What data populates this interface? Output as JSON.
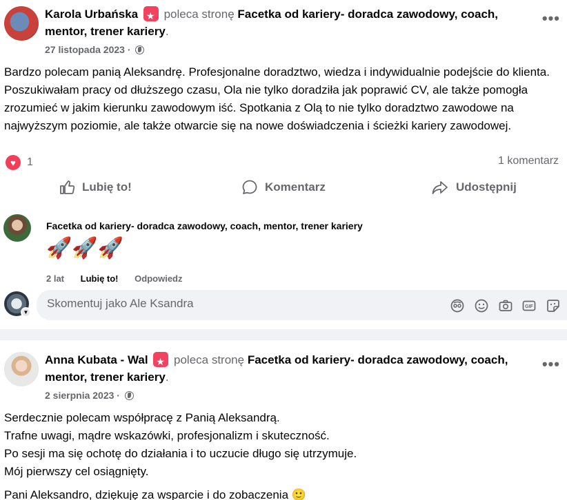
{
  "posts": [
    {
      "author": "Karola Urbańska",
      "recommends_text": "poleca stronę",
      "page": "Facetka od kariery- doradca zawodowy, coach, mentor, trener kariery",
      "date": "27 listopada 2023",
      "more": "•••",
      "body": "Bardzo polecam panią Aleksandrę. Profesjonalne doradztwo, wiedza i indywidualnie podejście do klienta. Poszukiwałam pracy od dłuższego czasu, Ola nie tylko doradziła jak poprawić CV, ale także pomogła zrozumieć w jakim kierunku zawodowym iść. Spotkania z Olą to nie tylko doradztwo zawodowe na najwyższym poziomie, ale także otwarcie się na nowe doświadczenia i ścieżki kariery zawodowej.",
      "reaction_count": "1",
      "comment_count": "1 komentarz",
      "actions": {
        "like": "Lubię to!",
        "comment": "Komentarz",
        "share": "Udostępnij"
      },
      "comment": {
        "author": "Facetka od kariery- doradca zawodowy, coach, mentor, trener kariery",
        "text": "🚀🚀🚀",
        "age": "2 lat",
        "like": "Lubię to!",
        "reply": "Odpowiedz"
      },
      "composer_placeholder": "Skomentuj jako Ale Ksandra"
    },
    {
      "author": "Anna Kubata - Wal",
      "recommends_text": "poleca stronę",
      "page": "Facetka od kariery- doradca zawodowy, coach, mentor, trener kariery",
      "date": "2 sierpnia 2023",
      "more": "•••",
      "body_lines": [
        "Serdecznie polecam współpracę z Panią Aleksandrą.",
        "Trafne uwagi, mądre wskazówki, profesjonalizm i skuteczność.",
        "Po sesji ma się ochotę do działania i to uczucie długo się utrzymuje.",
        "Mój pierwszy cel osiągnięty.",
        "Pani Aleksandro, dziękuję za wsparcie i do zobaczenia 🙂"
      ]
    }
  ],
  "icons": {
    "recommend": "recommend-star-icon",
    "globe": "globe-icon",
    "like": "thumbs-up-icon",
    "comment": "comment-bubble-icon",
    "share": "share-arrow-icon",
    "heart": "heart-icon",
    "composer_tools": [
      "avatar-sticker-icon",
      "emoji-icon",
      "camera-icon",
      "gif-icon",
      "sticker-icon"
    ]
  },
  "colors": {
    "accent_red": "#f33e58",
    "muted": "#65676b",
    "bg_gray": "#f0f2f5"
  }
}
